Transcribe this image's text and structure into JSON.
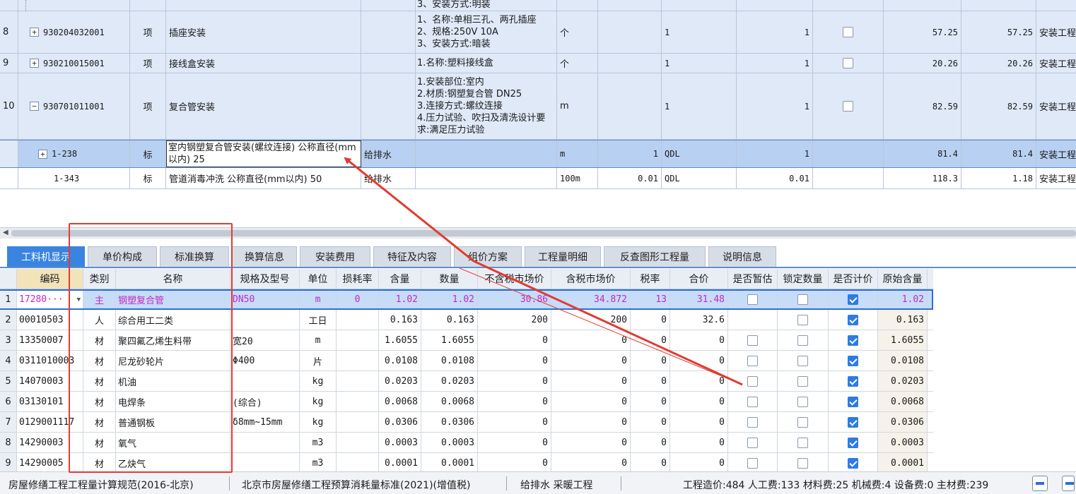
{
  "upper": {
    "top_partial": {
      "feature": "3、安装方式:明装"
    },
    "rows": [
      {
        "seq": "8",
        "code": "930204032001",
        "type": "项",
        "name": "插座安装",
        "major": "",
        "features": [
          "1、名称:单相三孔、两孔插座",
          "2、规格:250V 10A",
          "3、安装方式:暗装"
        ],
        "unit": "个",
        "qty_expr": "",
        "qdl": "1",
        "quantity": "1",
        "unit_price": "57.25",
        "total": "57.25",
        "category": "安装工程"
      },
      {
        "seq": "9",
        "code": "930210015001",
        "type": "项",
        "name": "接线盒安装",
        "major": "",
        "features": [
          "1.名称:塑料接线盒"
        ],
        "unit": "个",
        "qty_expr": "",
        "qdl": "1",
        "quantity": "1",
        "unit_price": "20.26",
        "total": "20.26",
        "category": "安装工程"
      },
      {
        "seq": "10",
        "code": "930701011001",
        "type": "项",
        "name": "复合管安装",
        "major": "",
        "features": [
          "1.安装部位:室内",
          "2.材质:钢塑复合管 DN25",
          "3.连接方式:螺纹连接",
          "4.压力试验、吹扫及清洗设计要求:满足压力试验"
        ],
        "unit": "m",
        "qty_expr": "",
        "qdl": "1",
        "quantity": "1",
        "unit_price": "82.59",
        "total": "82.59",
        "category": "安装工程"
      },
      {
        "seq": "",
        "code": "1-238",
        "type": "标",
        "name": "室内钢塑复合管安装(螺纹连接) 公称直径(mm以内) 25",
        "major": "给排水",
        "features": [],
        "unit": "m",
        "qty_expr": "1",
        "qdl": "QDL",
        "quantity": "1",
        "unit_price": "81.4",
        "total": "81.4",
        "category": "安装工程"
      },
      {
        "seq": "",
        "code": "1-343",
        "type": "标",
        "name": "管道消毒冲洗 公称直径(mm以内) 50",
        "major": "给排水",
        "features": [],
        "unit": "100m",
        "qty_expr": "0.01",
        "qdl": "QDL",
        "quantity": "0.01",
        "unit_price": "118.3",
        "total": "1.18",
        "category": "安装工程"
      }
    ]
  },
  "tabs": [
    "工料机显示",
    "单价构成",
    "标准换算",
    "换算信息",
    "安装费用",
    "特征及内容",
    "组价方案",
    "工程量明细",
    "反查图形工程量",
    "说明信息"
  ],
  "lower": {
    "headers": [
      "",
      "编码",
      "类别",
      "名称",
      "规格及型号",
      "单位",
      "损耗率",
      "含量",
      "数量",
      "不含税市场价",
      "含税市场价",
      "税率",
      "合价",
      "是否暂估",
      "锁定数量",
      "是否计价",
      "原始含量"
    ],
    "rows": [
      {
        "n": "1",
        "code": "17280···",
        "cat": "主",
        "name": "钢塑复合管",
        "spec": "DN50",
        "unit": "m",
        "loss": "0",
        "content": "1.02",
        "qty": "1.02",
        "price_ex": "30.86",
        "price_in": "34.872",
        "tax": "13",
        "total": "31.48",
        "provisional": false,
        "locked": false,
        "priced": true,
        "orig": "1.02"
      },
      {
        "n": "2",
        "code": "00010503",
        "cat": "人",
        "name": "综合用工二类",
        "spec": "",
        "unit": "工日",
        "loss": "",
        "content": "0.163",
        "qty": "0.163",
        "price_ex": "200",
        "price_in": "200",
        "tax": "0",
        "total": "32.6",
        "provisional": null,
        "locked": false,
        "priced": true,
        "orig": "0.163"
      },
      {
        "n": "3",
        "code": "13350007",
        "cat": "材",
        "name": "聚四氟乙烯生料带",
        "spec": "宽20",
        "unit": "m",
        "loss": "",
        "content": "1.6055",
        "qty": "1.6055",
        "price_ex": "0",
        "price_in": "0",
        "tax": "0",
        "total": "0",
        "provisional": false,
        "locked": false,
        "priced": true,
        "orig": "1.6055"
      },
      {
        "n": "4",
        "code": "0311010003",
        "cat": "材",
        "name": "尼龙砂轮片",
        "spec": "Φ400",
        "unit": "片",
        "loss": "",
        "content": "0.0108",
        "qty": "0.0108",
        "price_ex": "0",
        "price_in": "0",
        "tax": "0",
        "total": "0",
        "provisional": false,
        "locked": false,
        "priced": true,
        "orig": "0.0108"
      },
      {
        "n": "5",
        "code": "14070003",
        "cat": "材",
        "name": "机油",
        "spec": "",
        "unit": "kg",
        "loss": "",
        "content": "0.0203",
        "qty": "0.0203",
        "price_ex": "0",
        "price_in": "0",
        "tax": "0",
        "total": "0",
        "provisional": false,
        "locked": false,
        "priced": true,
        "orig": "0.0203"
      },
      {
        "n": "6",
        "code": "03130101",
        "cat": "材",
        "name": "电焊条",
        "spec": "(综合)",
        "unit": "kg",
        "loss": "",
        "content": "0.0068",
        "qty": "0.0068",
        "price_ex": "0",
        "price_in": "0",
        "tax": "0",
        "total": "0",
        "provisional": false,
        "locked": false,
        "priced": true,
        "orig": "0.0068"
      },
      {
        "n": "7",
        "code": "0129001117",
        "cat": "材",
        "name": "普通钢板",
        "spec": "δ8mm~15mm",
        "unit": "kg",
        "loss": "",
        "content": "0.0306",
        "qty": "0.0306",
        "price_ex": "0",
        "price_in": "0",
        "tax": "0",
        "total": "0",
        "provisional": false,
        "locked": false,
        "priced": true,
        "orig": "0.0306"
      },
      {
        "n": "8",
        "code": "14290003",
        "cat": "材",
        "name": "氧气",
        "spec": "",
        "unit": "m3",
        "loss": "",
        "content": "0.0003",
        "qty": "0.0003",
        "price_ex": "0",
        "price_in": "0",
        "tax": "0",
        "total": "0",
        "provisional": false,
        "locked": false,
        "priced": true,
        "orig": "0.0003"
      },
      {
        "n": "9",
        "code": "14290005",
        "cat": "材",
        "name": "乙炔气",
        "spec": "",
        "unit": "m3",
        "loss": "",
        "content": "0.0001",
        "qty": "0.0001",
        "price_ex": "0",
        "price_in": "0",
        "tax": "0",
        "total": "0",
        "provisional": false,
        "locked": false,
        "priced": true,
        "orig": "0.0001"
      }
    ]
  },
  "status": {
    "spec1": "房屋修缮工程工程量计算规范(2016-北京)",
    "spec2": "北京市房屋修缮工程预算消耗量标准(2021)(增值税)",
    "major": "给排水 采暖工程",
    "summary": "工程造价:484  人工费:133  材料费:25  机械费:4  设备费:0  主材费:239"
  },
  "colors": {
    "accent": "#3a84e0",
    "selected_row": "#b8d0f2",
    "annotation": "#e23b32",
    "main_material_text": "#c229c9"
  }
}
